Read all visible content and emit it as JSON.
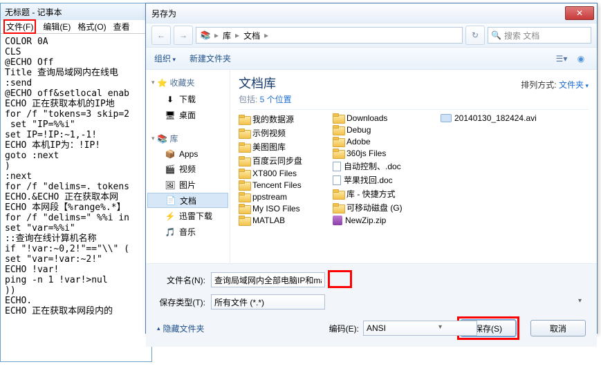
{
  "notepad": {
    "title": "无标题 - 记事本",
    "menu": {
      "file": "文件(F)",
      "edit": "编辑(E)",
      "format": "格式(O)",
      "view": "查看"
    },
    "content": "COLOR 0A\nCLS\n@ECHO Off\nTitle 查询局域网内在线电\n:send\n@ECHO off&setlocal enab\nECHO 正在获取本机的IP地\nfor /f \"tokens=3 skip=2\n set \"IP=%%i\"\nset IP=!IP:~1,-1!\nECHO 本机IP为：!IP!\ngoto :next\n)\n:next\nfor /f \"delims=. tokens\nECHO.&ECHO 正在获取本网\nECHO 本网段【%range%.*】\nfor /f \"delims=\" %%i in\nset \"var=%%i\"\n::查询在线计算机名称\nif \"!var:~0,2!\"==\"\\\\\" (\nset \"var=!var:~2!\"\nECHO !var!\nping -n 1 !var!>nul\n))\nECHO.\nECHO 正在获取本网段内的"
  },
  "dialog": {
    "title": "另存为",
    "close": "✕",
    "nav": {
      "back": "←",
      "fwd": "→",
      "lib": "库",
      "docs": "文档",
      "refresh": "↻",
      "search_ph": "搜索 文档",
      "search_icon": "🔍"
    },
    "toolbar": {
      "organize": "组织",
      "newfolder": "新建文件夹"
    },
    "sidebar": {
      "fav": "收藏夹",
      "fav_items": [
        {
          "icon": "⬇",
          "label": "下载"
        },
        {
          "icon": "🖥",
          "label": "桌面"
        }
      ],
      "lib": "库",
      "lib_items": [
        {
          "icon": "📦",
          "label": "Apps"
        },
        {
          "icon": "🎬",
          "label": "视频"
        },
        {
          "icon": "🖼",
          "label": "图片"
        },
        {
          "icon": "📄",
          "label": "文档",
          "sel": true
        },
        {
          "icon": "⚡",
          "label": "迅雷下载"
        },
        {
          "icon": "🎵",
          "label": "音乐"
        }
      ]
    },
    "main": {
      "title": "文档库",
      "sub_prefix": "包括: ",
      "sub_link": "5 个位置",
      "sort_label": "排列方式: ",
      "sort_value": "文件夹",
      "col1": [
        "我的数据源",
        "示例视频",
        "美图图库",
        "百度云同步盘",
        "XT800 Files",
        "Tencent Files",
        "ppstream",
        "My ISO Files",
        "MATLAB"
      ],
      "col2": [
        {
          "t": "folder",
          "n": "Downloads"
        },
        {
          "t": "folder",
          "n": "Debug"
        },
        {
          "t": "folder",
          "n": "Adobe"
        },
        {
          "t": "folder",
          "n": "360js Files"
        },
        {
          "t": "doc",
          "n": "自动控制、.doc"
        },
        {
          "t": "doc",
          "n": "苹果找回.doc"
        },
        {
          "t": "folder",
          "n": "库 - 快捷方式"
        },
        {
          "t": "folder",
          "n": "可移动磁盘 (G)"
        },
        {
          "t": "zip",
          "n": "NewZip.zip"
        }
      ],
      "col3": [
        {
          "t": "avi",
          "n": "20140130_182424.avi"
        }
      ]
    },
    "bottom": {
      "fn_label": "文件名(N):",
      "fn_value": "查询局域网内全部电脑IP和mac.bat",
      "type_label": "保存类型(T):",
      "type_value": "所有文件 (*.*)",
      "hide": "隐藏文件夹",
      "enc_label": "编码(E):",
      "enc_value": "ANSI",
      "save": "保存(S)",
      "cancel": "取消"
    }
  }
}
